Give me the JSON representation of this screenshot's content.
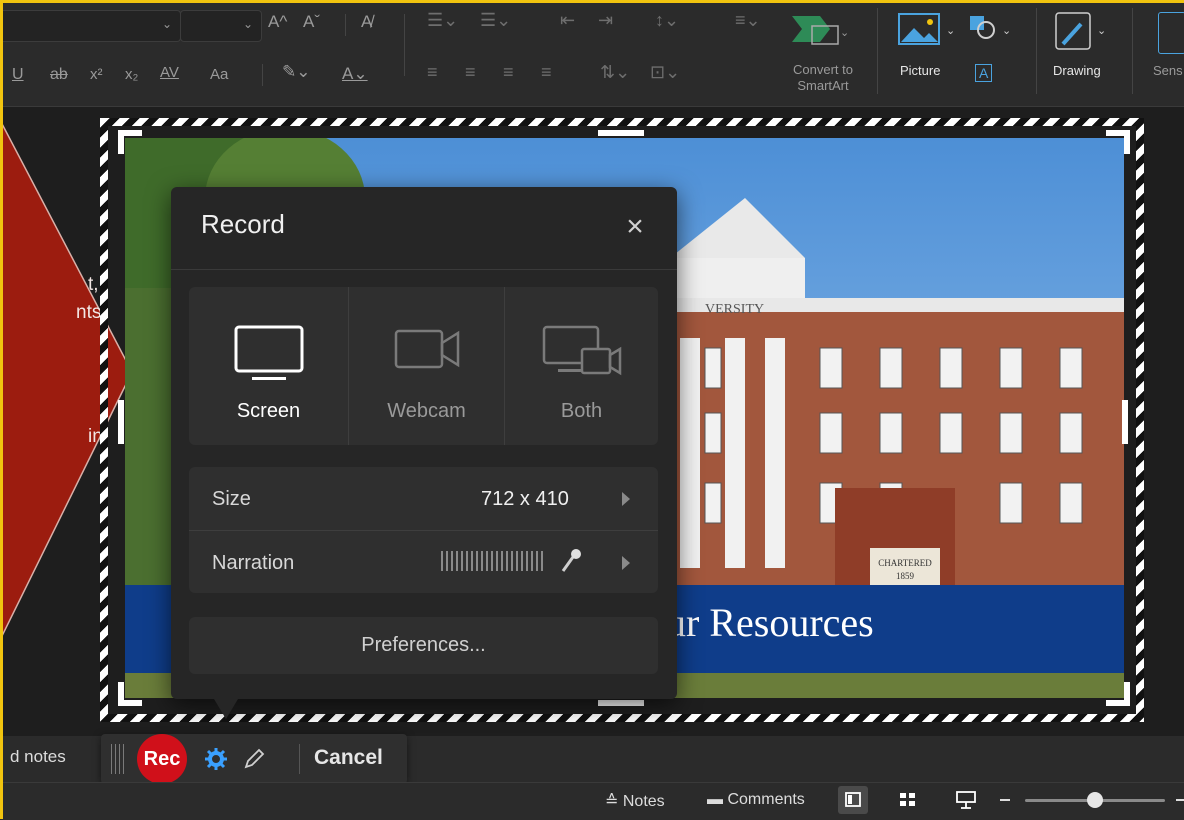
{
  "ribbon": {
    "superscript_label": "x²",
    "subscript_label": "x₂",
    "spacing_label": "AV",
    "case_label": "Aa",
    "underline_label": "U",
    "strike_label": "ab",
    "grow_font": "A^",
    "shrink_font": "Aˇ",
    "convert_label_line1": "Convert to",
    "convert_label_line2": "SmartArt",
    "picture_label": "Picture",
    "drawing_label": "Drawing",
    "sensitivity_label": "Sens"
  },
  "callout": {
    "line1": "t,",
    "line2": "nts",
    "line3": "in"
  },
  "slide": {
    "banner_text": "ur Resources",
    "building_sign": "VERSITY",
    "plaque_line1": "CHARTERED",
    "plaque_line2": "1859"
  },
  "record_panel": {
    "title": "Record",
    "modes": [
      {
        "label": "Screen",
        "icon": "monitor-icon",
        "selected": true
      },
      {
        "label": "Webcam",
        "icon": "camera-icon",
        "selected": false
      },
      {
        "label": "Both",
        "icon": "monitor-camera-icon",
        "selected": false
      }
    ],
    "size_label": "Size",
    "size_value": "712 x 410",
    "narration_label": "Narration",
    "preferences_label": "Preferences..."
  },
  "rec_toolbar": {
    "rec_label": "Rec",
    "cancel_label": "Cancel"
  },
  "status_bar": {
    "notes_left": "d notes",
    "notes_label": "Notes",
    "comments_label": "Comments"
  },
  "colors": {
    "rec_red": "#d0101a",
    "banner_blue": "#0f3d8a",
    "callout_red": "#9c1c0f",
    "frame_yellow": "#f1c40f",
    "settings_blue": "#3aa0ff"
  }
}
